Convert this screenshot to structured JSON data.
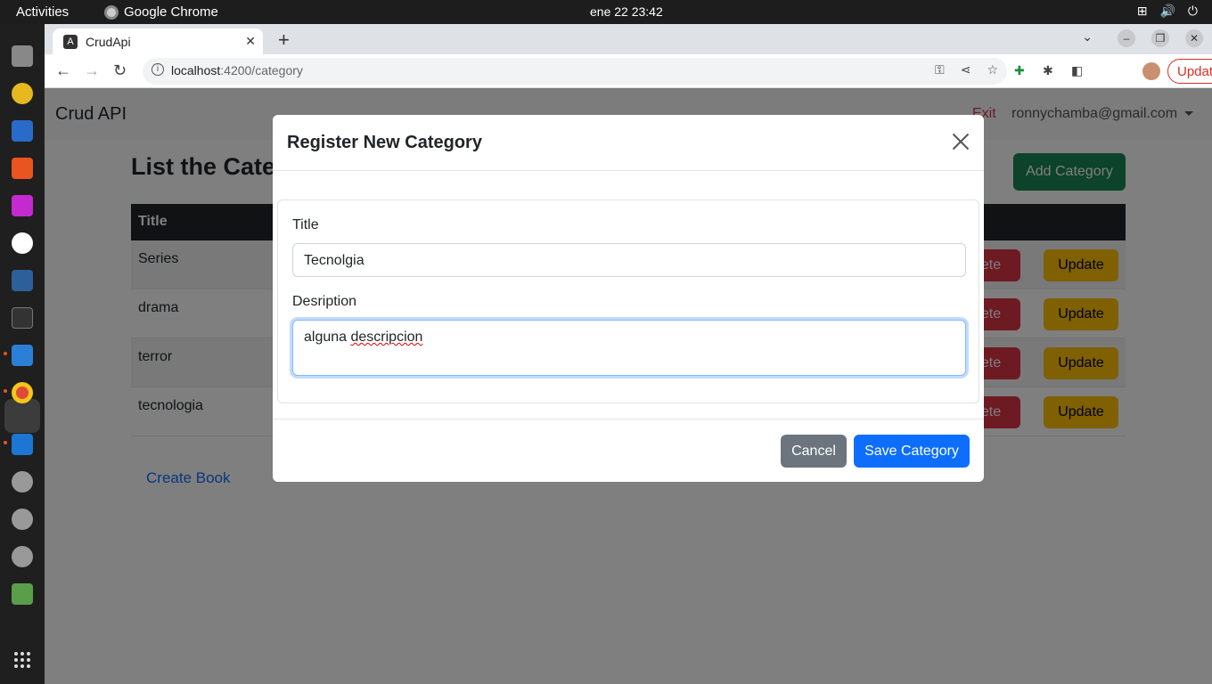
{
  "system": {
    "activities": "Activities",
    "app_name": "Google Chrome",
    "clock": "ene 22  23:42"
  },
  "browser": {
    "tab_title": "CrudApi",
    "url_host": "localhost",
    "url_rest": ":4200/category",
    "update_label": "Update"
  },
  "navbar": {
    "brand": "Crud API",
    "exit": "Exit",
    "user": "ronnychamba@gmail.com"
  },
  "page": {
    "heading": "List the Categories",
    "add_button": "Add Category",
    "table_header": "Title",
    "rows": [
      {
        "title": "Series",
        "delete": "Delete",
        "update": "Update"
      },
      {
        "title": "drama",
        "delete": "Delete",
        "update": "Update"
      },
      {
        "title": "terror",
        "delete": "Delete",
        "update": "Update"
      },
      {
        "title": "tecnologia",
        "delete": "Delete",
        "update": "Update"
      }
    ],
    "create_link": "Create Book"
  },
  "modal": {
    "title": "Register New Category",
    "title_label": "Title",
    "title_value": "Tecnolgia",
    "description_label": "Desription",
    "description_value_a": "alguna ",
    "description_value_b": "descripcion",
    "cancel": "Cancel",
    "save": "Save Category"
  },
  "colors": {
    "primary": "#0d6efd",
    "success": "#198754",
    "danger": "#dc3545",
    "warning": "#ffc107",
    "secondary": "#6c757d"
  }
}
